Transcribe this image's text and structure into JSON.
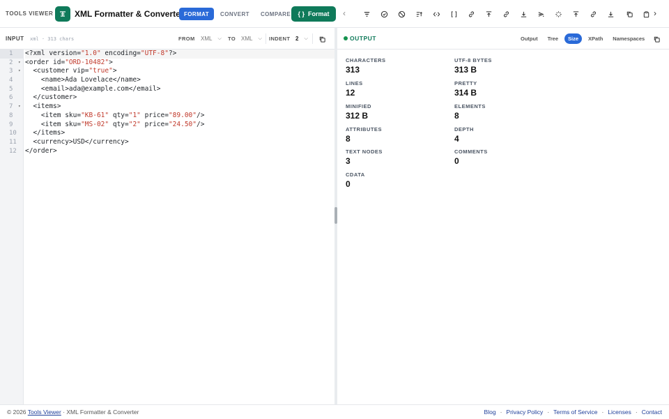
{
  "header": {
    "brand": "TOOLS VIEWER",
    "app_title": "XML Formatter & Converter",
    "modes": [
      "FORMAT",
      "CONVERT",
      "COMPARE"
    ],
    "active_mode": "FORMAT",
    "format_button": "Format",
    "toolbar_icons": [
      "filter-icon",
      "check-circle-icon",
      "ban-icon",
      "sort-icon",
      "code-brackets-icon",
      "square-brackets-icon",
      "link-icon",
      "upload-icon",
      "link-alt-icon",
      "download-icon",
      "send-icon",
      "sparkle-icon",
      "upload-alt-icon",
      "link-3-icon",
      "download-alt-icon",
      "copy-icon",
      "clipboard-icon"
    ]
  },
  "input": {
    "label": "INPUT",
    "meta": "xml · 313 chars",
    "from_label": "FROM",
    "from_value": "XML",
    "to_label": "TO",
    "to_value": "XML",
    "indent_label": "INDENT",
    "indent_value": "2",
    "line_numbers": [
      "1",
      "2",
      "3",
      "4",
      "5",
      "6",
      "7",
      "8",
      "9",
      "10",
      "11",
      "12"
    ],
    "fold_lines": [
      2,
      3,
      7
    ]
  },
  "output": {
    "label": "OUTPUT",
    "tabs": [
      "Output",
      "Tree",
      "Size",
      "XPath",
      "Namespaces"
    ],
    "active_tab": "Size",
    "stats": [
      {
        "label": "CHARACTERS",
        "value": "313"
      },
      {
        "label": "UTF-8 BYTES",
        "value": "313 B"
      },
      {
        "label": "LINES",
        "value": "12"
      },
      {
        "label": "PRETTY",
        "value": "314 B"
      },
      {
        "label": "MINIFIED",
        "value": "312 B"
      },
      {
        "label": "ELEMENTS",
        "value": "8"
      },
      {
        "label": "ATTRIBUTES",
        "value": "8"
      },
      {
        "label": "DEPTH",
        "value": "4"
      },
      {
        "label": "TEXT NODES",
        "value": "3"
      },
      {
        "label": "COMMENTS",
        "value": "0"
      },
      {
        "label": "CDATA",
        "value": "0"
      }
    ]
  },
  "footer": {
    "copyright": "© 2026",
    "site_link": "Tools Viewer",
    "suffix": "· XML Formatter & Converter",
    "links": [
      "Blog",
      "Privacy Policy",
      "Terms of Service",
      "Licenses",
      "Contact"
    ]
  },
  "code_lines": [
    [
      {
        "t": "<?xml version="
      },
      {
        "t": "\"1.0\"",
        "s": 1
      },
      {
        "t": " encoding="
      },
      {
        "t": "\"UTF-8\"",
        "s": 1
      },
      {
        "t": "?>"
      }
    ],
    [
      {
        "t": "<order id="
      },
      {
        "t": "\"ORD-10482\"",
        "s": 1
      },
      {
        "t": ">"
      }
    ],
    [
      {
        "t": "  <customer vip="
      },
      {
        "t": "\"true\"",
        "s": 1
      },
      {
        "t": ">"
      }
    ],
    [
      {
        "t": "    <name>Ada Lovelace</name>"
      }
    ],
    [
      {
        "t": "    <email>ada@example.com</email>"
      }
    ],
    [
      {
        "t": "  </customer>"
      }
    ],
    [
      {
        "t": "  <items>"
      }
    ],
    [
      {
        "t": "    <item sku="
      },
      {
        "t": "\"KB-61\"",
        "s": 1
      },
      {
        "t": " qty="
      },
      {
        "t": "\"1\"",
        "s": 1
      },
      {
        "t": " price="
      },
      {
        "t": "\"89.00\"",
        "s": 1
      },
      {
        "t": "/>"
      }
    ],
    [
      {
        "t": "    <item sku="
      },
      {
        "t": "\"MS-02\"",
        "s": 1
      },
      {
        "t": " qty="
      },
      {
        "t": "\"2\"",
        "s": 1
      },
      {
        "t": " price="
      },
      {
        "t": "\"24.50\"",
        "s": 1
      },
      {
        "t": "/>"
      }
    ],
    [
      {
        "t": "  </items>"
      }
    ],
    [
      {
        "t": "  <currency>USD</currency>"
      }
    ],
    [
      {
        "t": "</order>"
      }
    ]
  ]
}
